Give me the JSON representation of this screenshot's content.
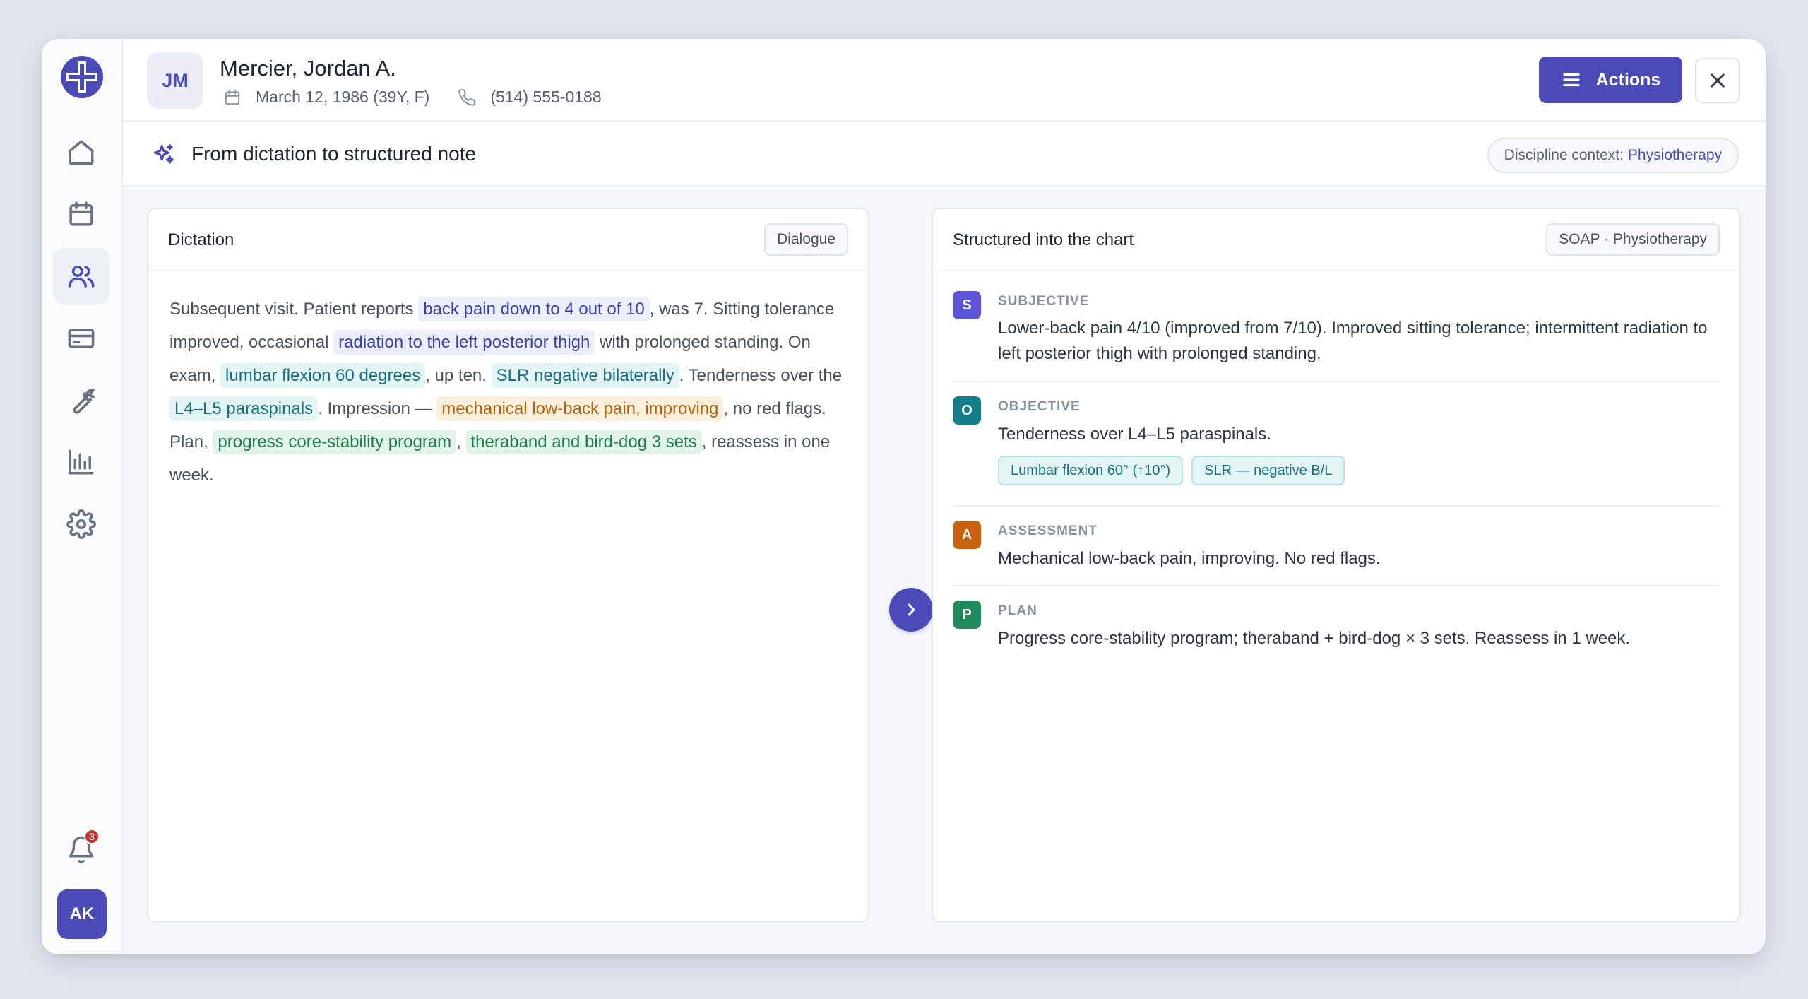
{
  "sidebar": {
    "logo_icon": "medical-cross-logo-icon",
    "nav": [
      {
        "name": "home",
        "icon": "home-icon"
      },
      {
        "name": "calendar",
        "icon": "calendar-icon"
      },
      {
        "name": "patients",
        "icon": "users-icon",
        "active": true
      },
      {
        "name": "billing",
        "icon": "credit-card-icon"
      },
      {
        "name": "tools",
        "icon": "wrench-icon"
      },
      {
        "name": "reports",
        "icon": "bar-chart-icon"
      },
      {
        "name": "settings",
        "icon": "gear-icon"
      }
    ],
    "notifications_count": "3",
    "user_initials": "AK"
  },
  "header": {
    "patient_initials": "JM",
    "patient_name": "Mercier, Jordan A.",
    "dob": "March 12, 1986 (39Y, F)",
    "phone": "(514) 555-0188",
    "actions_label": "Actions"
  },
  "subheader": {
    "title": "From dictation to structured note",
    "discipline_prefix": "Discipline context:",
    "discipline_value": "Physiotherapy"
  },
  "dictation": {
    "title": "Dictation",
    "tag": "Dialogue",
    "segments": [
      {
        "t": "Subsequent visit. Patient reports "
      },
      {
        "t": "back pain down to 4 out of 10",
        "hl": "indigo"
      },
      {
        "t": ", was 7. Sitting tolerance improved, occasional "
      },
      {
        "t": "radiation to the left posterior thigh",
        "hl": "indigo"
      },
      {
        "t": " with prolonged standing. On exam, "
      },
      {
        "t": "lumbar flexion 60 degrees",
        "hl": "teal"
      },
      {
        "t": ", up ten. "
      },
      {
        "t": "SLR negative bilaterally",
        "hl": "teal"
      },
      {
        "t": ". Tenderness over the "
      },
      {
        "t": "L4–L5 paraspinals",
        "hl": "teal"
      },
      {
        "t": ". Impression — "
      },
      {
        "t": "mechanical low-back pain, improving",
        "hl": "orange"
      },
      {
        "t": ", no red flags. Plan, "
      },
      {
        "t": "progress core-stability program",
        "hl": "green"
      },
      {
        "t": ", "
      },
      {
        "t": "theraband and bird-dog 3 sets",
        "hl": "green"
      },
      {
        "t": ", reassess in one week."
      }
    ]
  },
  "structured": {
    "title": "Structured into the chart",
    "tag": "SOAP · Physiotherapy",
    "sections": {
      "s": {
        "letter": "S",
        "label": "SUBJECTIVE",
        "color": "#5b55d6",
        "text": "Lower-back pain 4/10 (improved from 7/10). Improved sitting tolerance; intermittent radiation to left posterior thigh with prolonged standing."
      },
      "o": {
        "letter": "O",
        "label": "OBJECTIVE",
        "color": "#147d8a",
        "text": "Tenderness over L4–L5 paraspinals.",
        "chips": [
          "Lumbar flexion 60° (↑10°)",
          "SLR — negative B/L"
        ]
      },
      "a": {
        "letter": "A",
        "label": "ASSESSMENT",
        "color": "#c9620f",
        "text": "Mechanical low-back pain, improving. No red flags."
      },
      "p": {
        "letter": "P",
        "label": "PLAN",
        "color": "#1f8a5a",
        "text": "Progress core-stability program; theraband + bird-dog × 3 sets. Reassess in 1 week."
      }
    }
  },
  "colors": {
    "accent": "#4a4bb8",
    "highlight_indigo": "#eceefb",
    "highlight_teal": "#e3f4f5",
    "highlight_orange": "#fcefdc",
    "highlight_green": "#e2f3ea"
  }
}
